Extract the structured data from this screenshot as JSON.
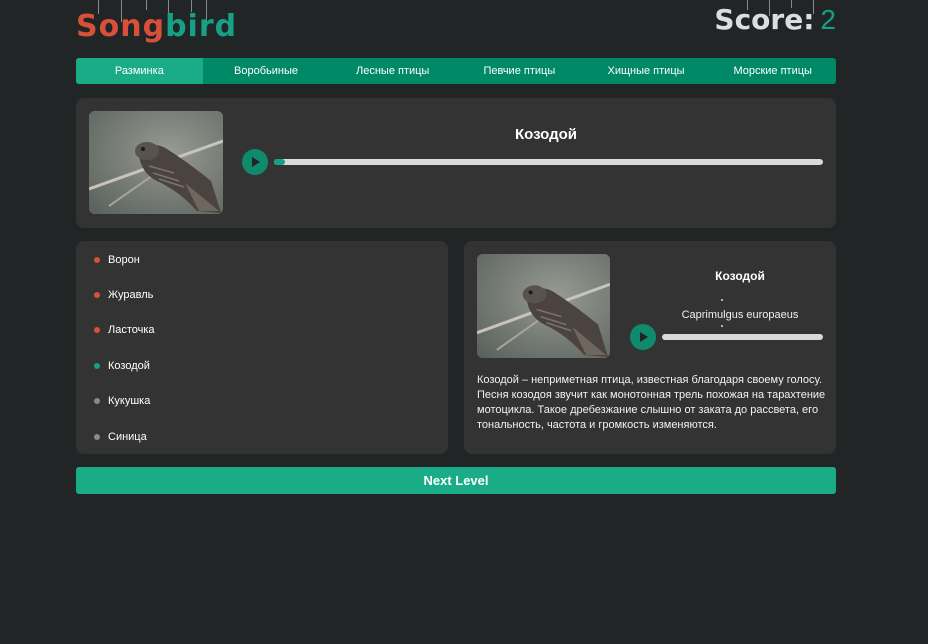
{
  "header": {
    "logo_song": "Song",
    "logo_bird": "bird",
    "score_label": "Score:",
    "score_value": "2"
  },
  "nav": {
    "items": [
      {
        "label": "Разминка",
        "active": true
      },
      {
        "label": "Воробьиные",
        "active": false
      },
      {
        "label": "Лесные птицы",
        "active": false
      },
      {
        "label": "Певчие птицы",
        "active": false
      },
      {
        "label": "Хищные птицы",
        "active": false
      },
      {
        "label": "Морские птицы",
        "active": false
      }
    ]
  },
  "current_bird": {
    "name": "Козодой",
    "audio_progress": 0.02
  },
  "answers": [
    {
      "label": "Ворон",
      "status": "wrong"
    },
    {
      "label": "Журавль",
      "status": "wrong"
    },
    {
      "label": "Ласточка",
      "status": "wrong"
    },
    {
      "label": "Козодой",
      "status": "correct"
    },
    {
      "label": "Кукушка",
      "status": "untried"
    },
    {
      "label": "Синица",
      "status": "untried"
    }
  ],
  "details": {
    "name": "Козодой",
    "latin_name": "Caprimulgus europaeus",
    "audio_progress": 0,
    "description": "Козодой – неприметная птица, известная благодаря своему голосу. Песня козодоя звучит как монотонная трель похожая на тарахтение мотоцикла. Такое дребезжание слышно от заката до рассвета, его тональность, частота и громкость изменяются."
  },
  "next_level_label": "Next Level",
  "colors": {
    "background": "#222526",
    "panel": "#333333",
    "accent": "#1aac87",
    "nav": "#008966",
    "wrong": "#d9503a",
    "correct": "#16a085",
    "untried": "#8a8a8a"
  },
  "icons": {
    "play": "play-icon",
    "dot": "status-dot-icon"
  }
}
